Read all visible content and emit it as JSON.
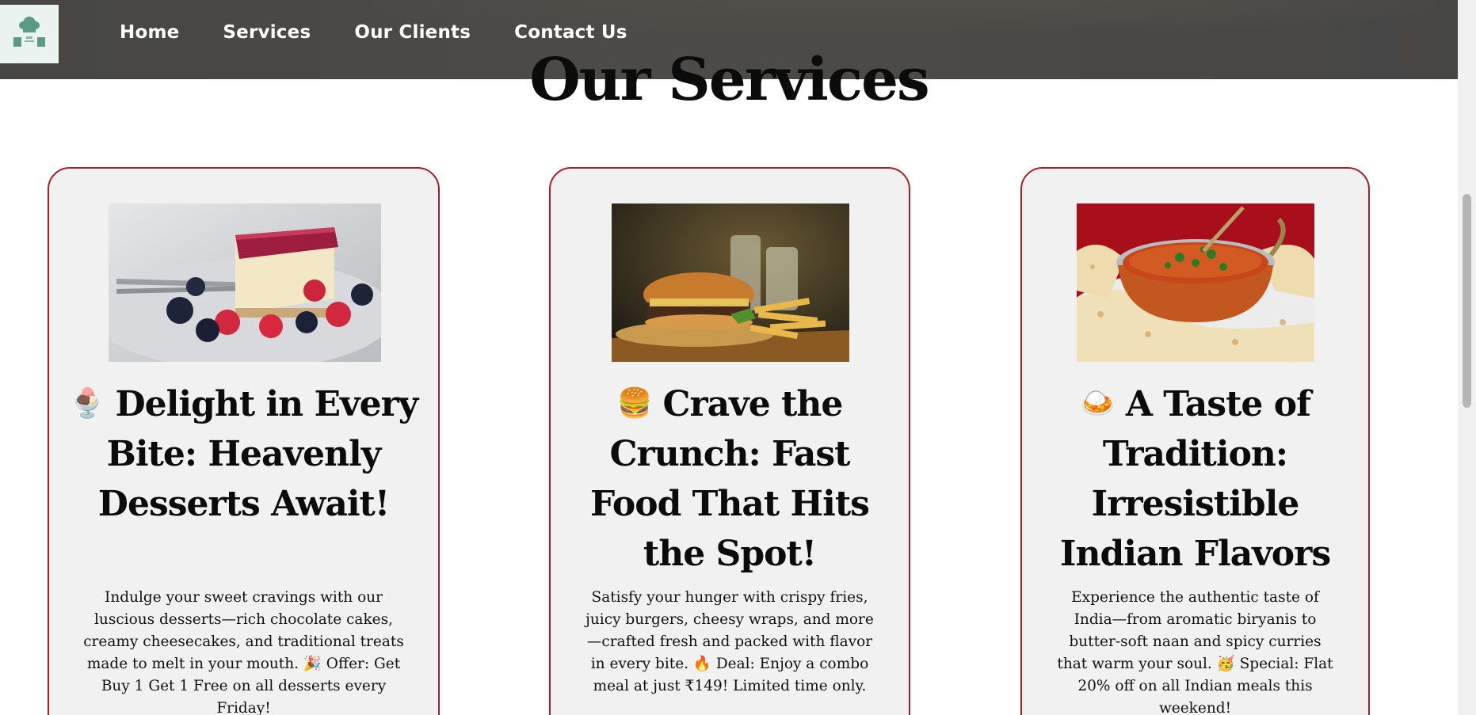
{
  "nav": {
    "logo_alt": "FOOD HUB",
    "links": [
      {
        "label": "Home"
      },
      {
        "label": "Services"
      },
      {
        "label": "Our Clients"
      },
      {
        "label": "Contact Us"
      }
    ]
  },
  "page": {
    "title": "Our Services"
  },
  "cards": [
    {
      "emoji": "🍨",
      "title": "Delight in Every Bite: Heavenly Desserts Await!",
      "description": "Indulge your sweet cravings with our luscious desserts—rich chocolate cakes, creamy cheesecakes, and traditional treats made to melt in your mouth. 🎉 Offer: Get Buy 1 Get 1 Free on all desserts every Friday!",
      "photo_name": "cheesecake-with-berries"
    },
    {
      "emoji": "🍔",
      "title": "Crave the Crunch: Fast Food That Hits the Spot!",
      "description": "Satisfy your hunger with crispy fries, juicy burgers, cheesy wraps, and more—crafted fresh and packed with flavor in every bite. 🔥 Deal: Enjoy a combo meal at just ₹149! Limited time only.",
      "photo_name": "burger-and-fries"
    },
    {
      "emoji": "🍛",
      "title": "A Taste of Tradition: Irresistible Indian Flavors",
      "description": "Experience the authentic taste of India—from aromatic biryanis to butter-soft naan and spicy curries that warm your soul. 🥳 Special: Flat 20% off on all Indian meals this weekend!",
      "photo_name": "curry-and-naan"
    }
  ],
  "colors": {
    "nav_bg": "#484848",
    "card_border": "#a3202a",
    "card_bg": "#f1f1f1",
    "text": "#0b0b0b"
  }
}
